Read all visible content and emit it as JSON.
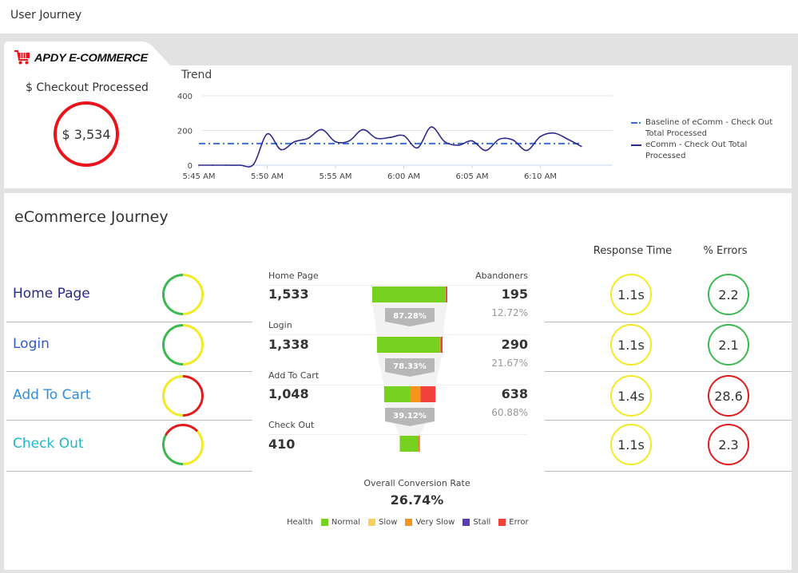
{
  "page": {
    "title": "User Journey"
  },
  "header": {
    "brand": "APDY E-COMMERCE",
    "checkout_label": "$ Checkout Processed",
    "checkout_value": "$ 3,534",
    "checkout_status_color": "#e8141a",
    "trend_title": "Trend"
  },
  "chart_data": {
    "type": "line",
    "title": "Trend",
    "xlabel": "",
    "ylabel": "",
    "ylim": [
      0,
      400
    ],
    "yticks": [
      0,
      200,
      400
    ],
    "x_ticks": [
      "5:45 AM",
      "5:50 AM",
      "5:55 AM",
      "6:00 AM",
      "6:05 AM",
      "6:10 AM"
    ],
    "x": [
      0,
      1,
      2,
      3,
      4,
      5,
      6,
      7,
      8,
      9,
      10,
      11,
      12,
      13,
      14,
      15,
      16,
      17,
      18,
      19,
      20,
      21,
      22,
      23,
      24,
      25,
      26,
      27,
      28
    ],
    "x_unit": "minutes after 5:45 AM",
    "grid": true,
    "legend_position": "right",
    "series": [
      {
        "name": "Baseline of eComm - Check Out Total Processed",
        "style": "dash-dot",
        "color": "#3a6fd8",
        "values": [
          125,
          125,
          125,
          125,
          125,
          125,
          125,
          125,
          125,
          125,
          125,
          125,
          125,
          125,
          125,
          125,
          125,
          125,
          125,
          125,
          125,
          125,
          125,
          125,
          125,
          125,
          125,
          125,
          125
        ]
      },
      {
        "name": "eComm - Check Out Total Processed",
        "style": "solid",
        "color": "#2d2a8e",
        "values": [
          0,
          0,
          0,
          0,
          5,
          180,
          90,
          135,
          155,
          205,
          135,
          140,
          205,
          155,
          160,
          170,
          100,
          220,
          135,
          115,
          140,
          85,
          150,
          145,
          85,
          165,
          185,
          150,
          108
        ]
      }
    ]
  },
  "journey": {
    "title": "eCommerce Journey",
    "columns": {
      "response_time": "Response Time",
      "errors": "% Errors",
      "abandoners": "Abandoners"
    },
    "steps": [
      {
        "name": "Home Page",
        "name_color": "#2b2a8e",
        "health": [
          {
            "color": "#3cb850",
            "share": 0.5
          },
          {
            "color": "#f2ea22",
            "share": 0.5
          }
        ],
        "count": "1,533",
        "abandoners": "195",
        "abandon_pct": "12.72%",
        "conversion": "87.28%",
        "response_time": "1.1s",
        "rt_color": "#f2ea22",
        "errors": "2.2",
        "err_color": "#3cb850",
        "bar": {
          "fraction": 1.0,
          "normal": 0.97,
          "very_slow": 0.01,
          "error": 0.02
        }
      },
      {
        "name": "Login",
        "name_color": "#2f5bc7",
        "health": [
          {
            "color": "#3cb850",
            "share": 0.5
          },
          {
            "color": "#f2ea22",
            "share": 0.5
          }
        ],
        "count": "1,338",
        "abandoners": "290",
        "abandon_pct": "21.67%",
        "conversion": "78.33%",
        "response_time": "1.1s",
        "rt_color": "#f2ea22",
        "errors": "2.1",
        "err_color": "#3cb850",
        "bar": {
          "fraction": 0.873,
          "normal": 0.96,
          "very_slow": 0.01,
          "error": 0.03
        }
      },
      {
        "name": "Add To Cart",
        "name_color": "#2e8fdf",
        "health": [
          {
            "color": "#f2ea22",
            "share": 0.5
          },
          {
            "color": "#e01b1b",
            "share": 0.5
          }
        ],
        "count": "1,048",
        "abandoners": "638",
        "abandon_pct": "60.88%",
        "conversion": "39.12%",
        "response_time": "1.4s",
        "rt_color": "#f2ea22",
        "errors": "28.6",
        "err_color": "#e01b1b",
        "bar": {
          "fraction": 0.684,
          "normal": 0.5,
          "very_slow": 0.21,
          "error": 0.29
        }
      },
      {
        "name": "Check Out",
        "name_color": "#1fb8c9",
        "health": [
          {
            "color": "#3cb850",
            "share": 0.33
          },
          {
            "color": "#e01b1b",
            "share": 0.3
          },
          {
            "color": "#f2ea22",
            "share": 0.37
          }
        ],
        "count": "410",
        "abandoners": "",
        "abandon_pct": "",
        "conversion": "",
        "response_time": "1.1s",
        "rt_color": "#f2ea22",
        "errors": "2.3",
        "err_color": "#e01b1b",
        "bar": {
          "fraction": 0.267,
          "normal": 0.94,
          "very_slow": 0.02,
          "error": 0.04
        }
      }
    ],
    "overall_label": "Overall Conversion Rate",
    "overall_value": "26.74%",
    "health_legend": {
      "label": "Health",
      "items": [
        {
          "name": "Normal",
          "color": "#76d21e"
        },
        {
          "name": "Slow",
          "color": "#f8cf5a"
        },
        {
          "name": "Very Slow",
          "color": "#f7941d"
        },
        {
          "name": "Stall",
          "color": "#5b3bb5"
        },
        {
          "name": "Error",
          "color": "#f2403a"
        }
      ]
    }
  }
}
